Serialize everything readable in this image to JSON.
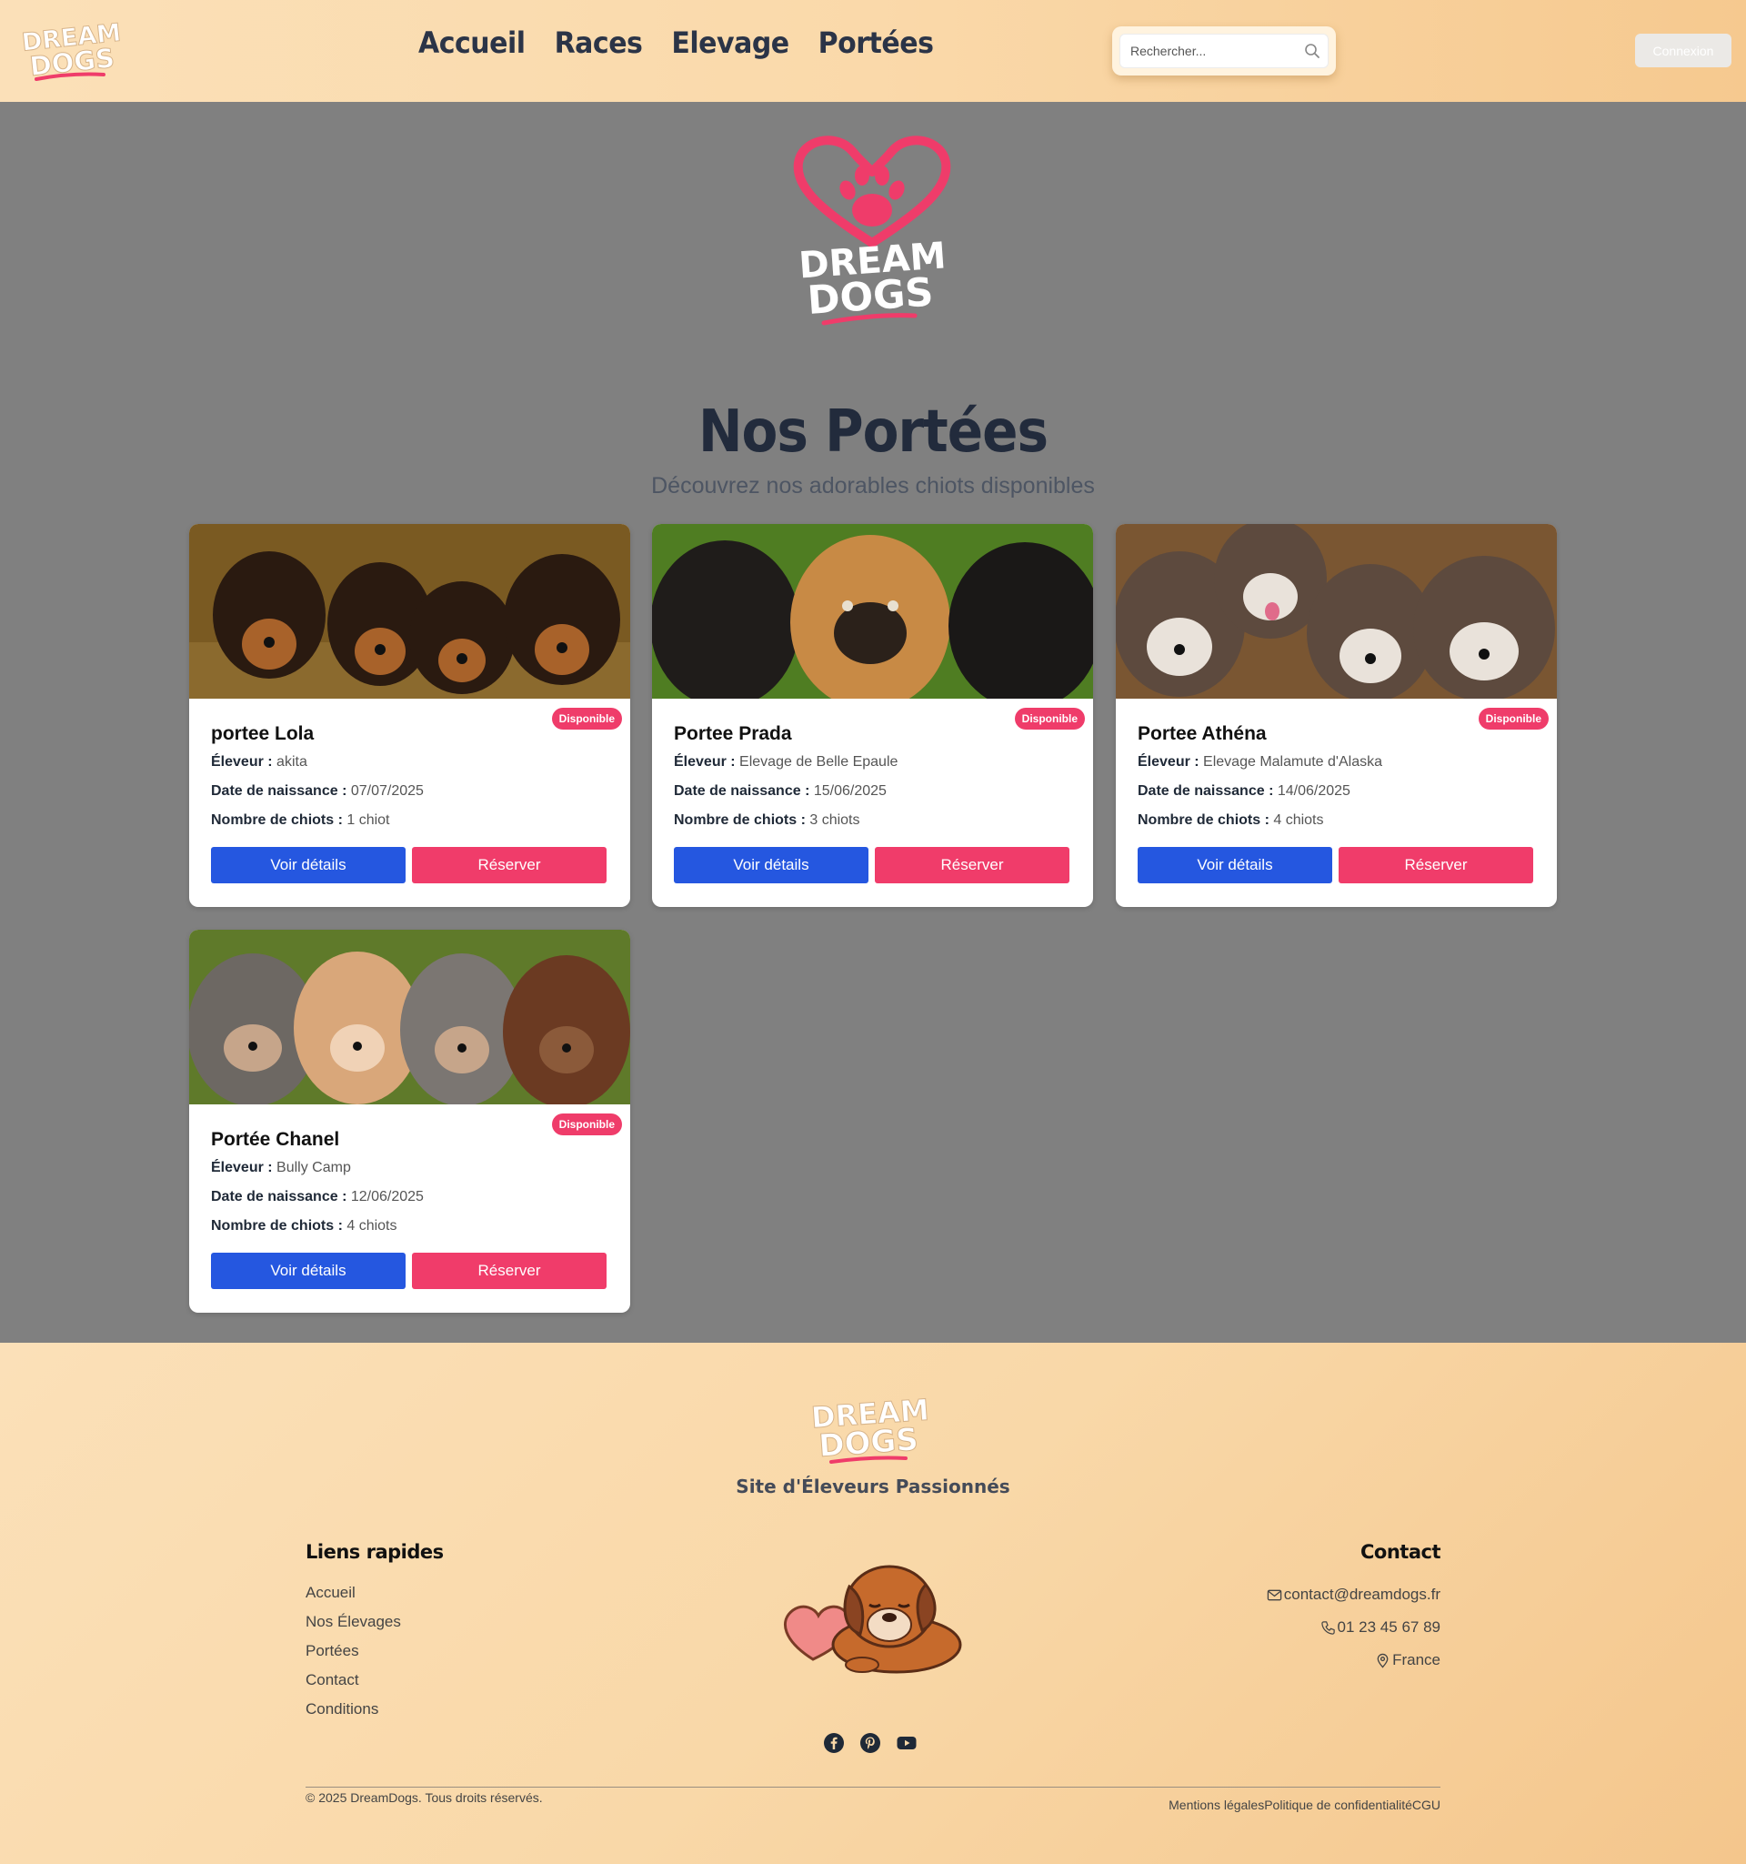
{
  "header": {
    "logo_line1": "DREAM",
    "logo_line2": "DOGS",
    "nav": [
      "Accueil",
      "Races",
      "Elevage",
      "Portées"
    ],
    "search_placeholder": "Rechercher...",
    "login_label": "Connexion"
  },
  "hero": {
    "logo_line1": "DREAM",
    "logo_line2": "DOGS",
    "title": "Nos Portées",
    "subtitle": "Découvrez nos adorables chiots disponibles"
  },
  "labels": {
    "breeder": "Éleveur :",
    "birthdate": "Date de naissance :",
    "count": "Nombre de chiots :",
    "details": "Voir détails",
    "reserve": "Réserver"
  },
  "litters": [
    {
      "title": "portee Lola",
      "badge": "Disponible",
      "breeder": "akita",
      "birthdate": "07/07/2025",
      "count": "1 chiot"
    },
    {
      "title": "Portee Prada",
      "badge": "Disponible",
      "breeder": "Elevage de Belle Epaule",
      "birthdate": "15/06/2025",
      "count": "3 chiots"
    },
    {
      "title": "Portee Athéna",
      "badge": "Disponible",
      "breeder": "Elevage Malamute d'Alaska",
      "birthdate": "14/06/2025",
      "count": "4 chiots"
    },
    {
      "title": "Portée Chanel",
      "badge": "Disponible",
      "breeder": "Bully Camp",
      "birthdate": "12/06/2025",
      "count": "4 chiots"
    }
  ],
  "footer": {
    "logo_line1": "DREAM",
    "logo_line2": "DOGS",
    "tagline": "Site d'Éleveurs Passionnés",
    "links_title": "Liens rapides",
    "links": [
      "Accueil",
      "Nos Élevages",
      "Portées",
      "Contact",
      "Conditions"
    ],
    "contact_title": "Contact",
    "email": "contact@dreamdogs.fr",
    "phone": "01 23 45 67 89",
    "location": "France",
    "socials": [
      "facebook-icon",
      "pinterest-icon",
      "youtube-icon"
    ],
    "copyright": "© 2025 DreamDogs. Tous droits réservés.",
    "legal": [
      "Mentions légales",
      "Politique de confidentialité",
      "CGU"
    ]
  },
  "colors": {
    "accent_pink": "#ef3c6a",
    "primary_blue": "#2557e0",
    "header_peach": "#fad9aa",
    "page_gray": "#808080"
  }
}
